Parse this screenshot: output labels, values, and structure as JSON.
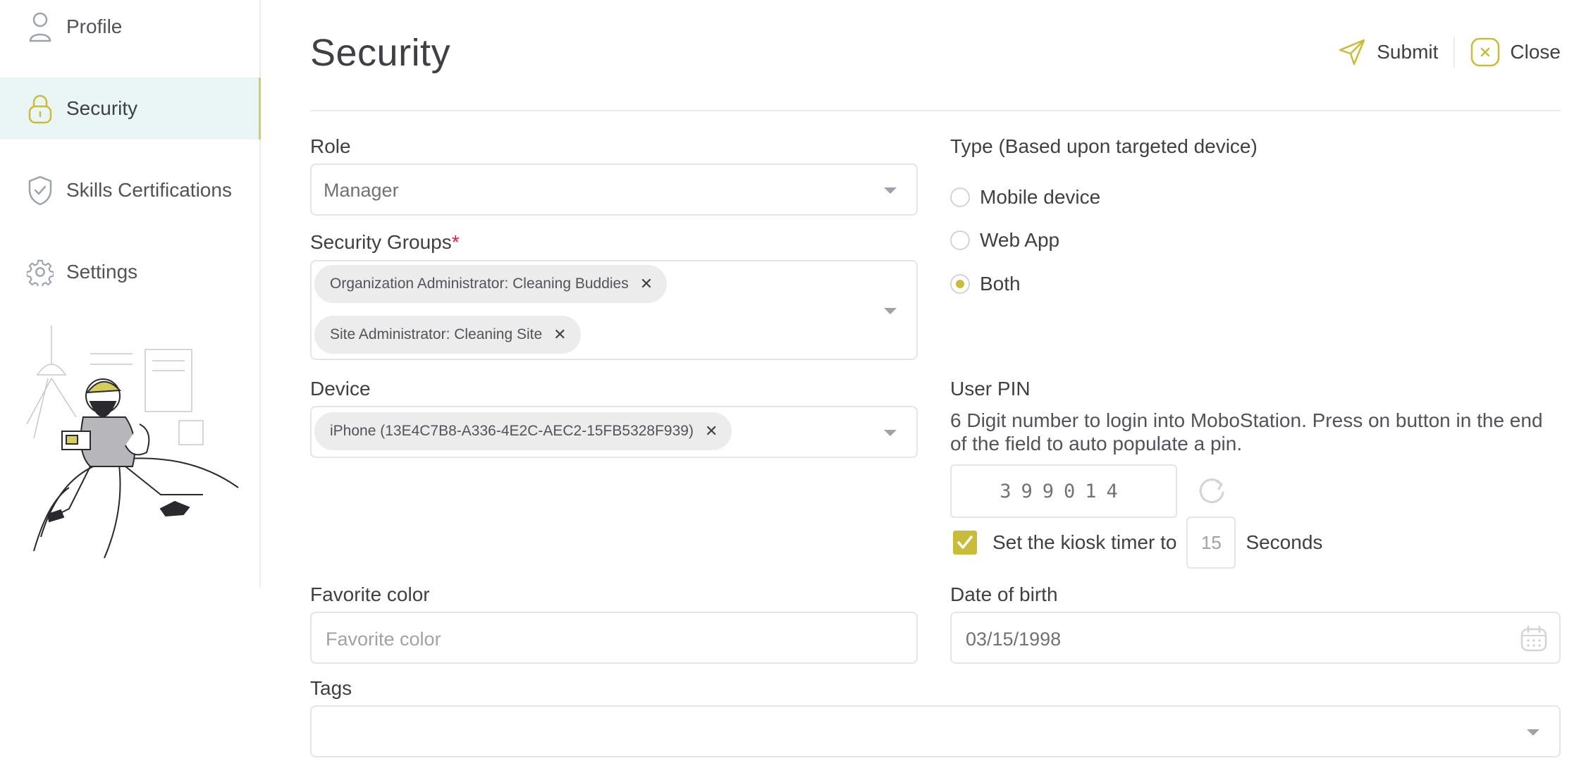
{
  "sidebar": {
    "items": [
      {
        "label": "Profile",
        "icon": "user-icon"
      },
      {
        "label": "Security",
        "icon": "lock-icon",
        "active": true
      },
      {
        "label": "Skills Certifications",
        "icon": "shield-check-icon"
      },
      {
        "label": "Settings",
        "icon": "gear-icon"
      }
    ]
  },
  "header": {
    "title": "Security",
    "submit_label": "Submit",
    "close_label": "Close"
  },
  "form": {
    "role": {
      "label": "Role",
      "value": "Manager"
    },
    "security_groups": {
      "label": "Security Groups",
      "required_mark": "*",
      "chips": [
        "Organization Administrator: Cleaning Buddies",
        "Site Administrator: Cleaning Site"
      ]
    },
    "device": {
      "label": "Device",
      "chips": [
        "iPhone (13E4C7B8-A336-4E2C-AEC2-15FB5328F939)"
      ]
    },
    "type": {
      "label": "Type (Based upon targeted device)",
      "options": [
        "Mobile device",
        "Web App",
        "Both"
      ],
      "selected": "Both"
    },
    "user_pin": {
      "label": "User PIN",
      "helper": "6 Digit number to login into MoboStation. Press on button in the end of the field to auto populate a pin.",
      "value": "399014"
    },
    "kiosk": {
      "checked": true,
      "prefix": "Set the kiosk timer to",
      "value": "15",
      "suffix": "Seconds"
    },
    "favorite_color": {
      "label": "Favorite color",
      "placeholder": "Favorite color"
    },
    "date_of_birth": {
      "label": "Date of birth",
      "value": "03/15/1998"
    },
    "tags": {
      "label": "Tags"
    }
  },
  "colors": {
    "accent": "#c9bc3a",
    "active_bg": "#eaf6f5",
    "required": "#e11d48"
  }
}
